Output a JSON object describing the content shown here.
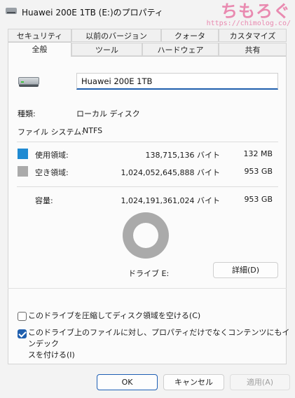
{
  "window": {
    "title": "Huawei 200E 1TB (E:)のプロパティ",
    "watermark_logo": "ちもろぐ",
    "watermark_url": "https://chimolog.co/"
  },
  "tabs": {
    "row1": [
      "セキュリティ",
      "以前のバージョン",
      "クォータ",
      "カスタマイズ"
    ],
    "row2": [
      "全般",
      "ツール",
      "ハードウェア",
      "共有"
    ],
    "active": "全般"
  },
  "general": {
    "drive_name": "Huawei 200E 1TB",
    "type_label": "種類:",
    "type_value": "ローカル ディスク",
    "fs_label": "ファイル システム:",
    "fs_value": "NTFS",
    "used_label": "使用領域:",
    "used_bytes": "138,715,136 バイト",
    "used_size": "132 MB",
    "free_label": "空き領域:",
    "free_bytes": "1,024,052,645,888 バイト",
    "free_size": "953 GB",
    "capacity_label": "容量:",
    "capacity_bytes": "1,024,191,361,024 バイト",
    "capacity_size": "953 GB",
    "drive_label": "ドライブ E:",
    "details_button": "詳細(D)",
    "compress_label": "このドライブを圧縮してディスク領域を空ける(C)",
    "compress_checked": false,
    "index_label_line1": "このドライブ上のファイルに対し、プロパティだけでなくコンテンツにもインデック",
    "index_label_line2": "スを付ける(I)",
    "index_checked": true,
    "used_fraction": 0.0001
  },
  "colors": {
    "used": "#1f8ad2",
    "free": "#aaaaaa",
    "accent": "#1f5fae"
  },
  "footer": {
    "ok": "OK",
    "cancel": "キャンセル",
    "apply": "適用(A)"
  },
  "icons": [
    "drive-icon",
    "checkmark-icon"
  ]
}
